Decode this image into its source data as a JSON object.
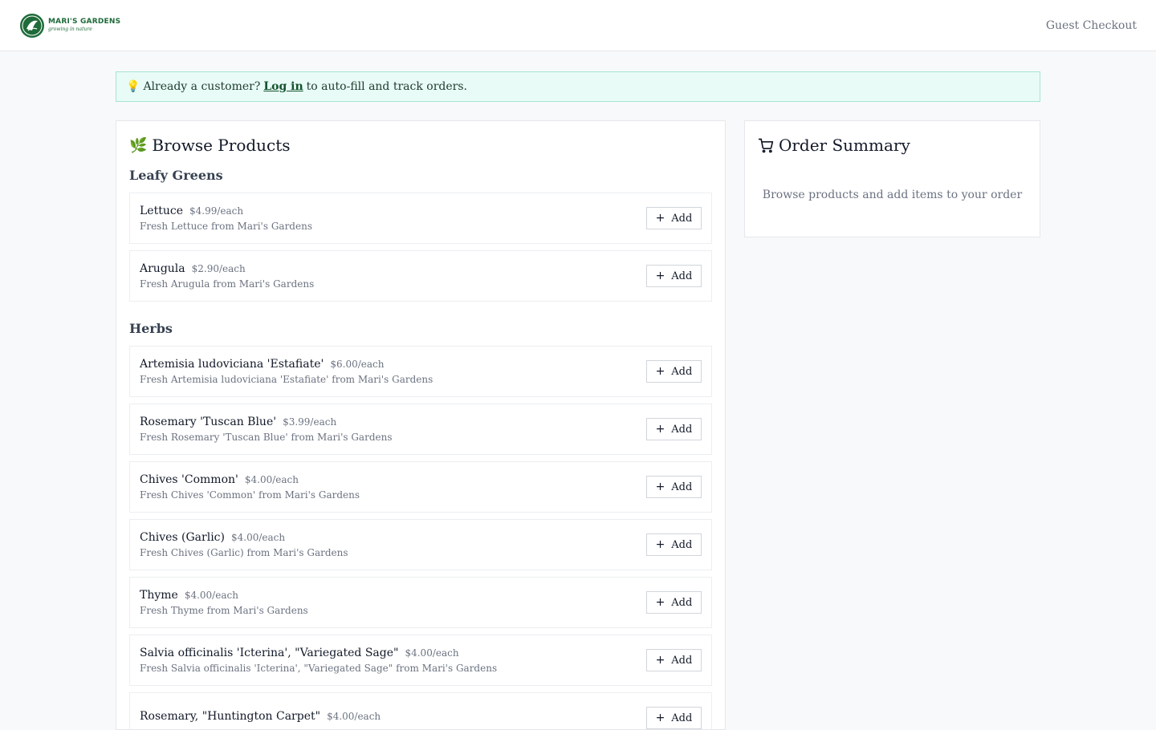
{
  "header": {
    "logo": {
      "name": "MARI'S GARDENS",
      "tagline": "growing in nature"
    },
    "guest_checkout": "Guest Checkout"
  },
  "notice": {
    "icon": "lightbulb-icon",
    "prefix": "Already a customer?",
    "login_link": "Log in",
    "suffix": "to auto-fill and track orders."
  },
  "browse": {
    "icon": "leaf-icon",
    "title": "Browse Products",
    "add_label": "Add",
    "sections": [
      {
        "title": "Leafy Greens",
        "products": [
          {
            "name": "Lettuce",
            "price": "$4.99/each",
            "desc": "Fresh Lettuce from Mari's Gardens"
          },
          {
            "name": "Arugula",
            "price": "$2.90/each",
            "desc": "Fresh Arugula from Mari's Gardens"
          }
        ]
      },
      {
        "title": "Herbs",
        "products": [
          {
            "name": "Artemisia ludoviciana 'Estafiate'",
            "price": "$6.00/each",
            "desc": "Fresh Artemisia ludoviciana 'Estafiate' from Mari's Gardens"
          },
          {
            "name": "Rosemary 'Tuscan Blue'",
            "price": "$3.99/each",
            "desc": "Fresh Rosemary 'Tuscan Blue' from Mari's Gardens"
          },
          {
            "name": "Chives 'Common'",
            "price": "$4.00/each",
            "desc": "Fresh Chives 'Common' from Mari's Gardens"
          },
          {
            "name": "Chives (Garlic)",
            "price": "$4.00/each",
            "desc": "Fresh Chives (Garlic) from Mari's Gardens"
          },
          {
            "name": "Thyme",
            "price": "$4.00/each",
            "desc": "Fresh Thyme from Mari's Gardens"
          },
          {
            "name": "Salvia officinalis 'Icterina', \"Variegated Sage\"",
            "price": "$4.00/each",
            "desc": "Fresh Salvia officinalis 'Icterina', \"Variegated Sage\" from Mari's Gardens"
          },
          {
            "name": "Rosemary, \"Huntington Carpet\"",
            "price": "$4.00/each",
            "desc": ""
          }
        ]
      }
    ]
  },
  "summary": {
    "icon": "cart-icon",
    "title": "Order Summary",
    "empty_text": "Browse products and add items to your order"
  }
}
